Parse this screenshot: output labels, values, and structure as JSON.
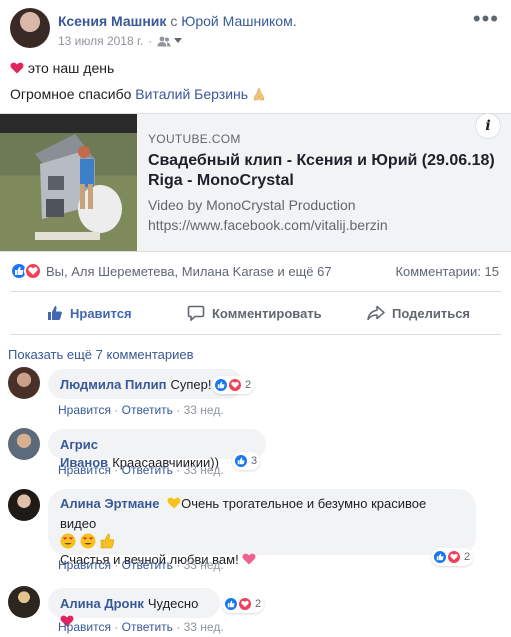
{
  "post": {
    "author": "Ксения Машник",
    "with_word": "с",
    "tagged": "Юрой Машником.",
    "date": "13 июля 2018 г.",
    "audience_icon": "friends-icon",
    "line1_text": "это наш день",
    "line2_text": "Огромное спасибо",
    "line2_link": "Виталий Берзинь"
  },
  "preview": {
    "source": "YOUTUBE.COM",
    "title": "Свадебный клип - Ксения и Юрий (29.06.18) Riga - MonoCrystal",
    "desc1": "Video by MonoCrystal Production",
    "desc2": "https://www.facebook.com/vitalij.berzin",
    "info": "i"
  },
  "reactions": {
    "summary": "Вы, Аля Шереметева, Милана Karase и ещё 67",
    "comments_count": "Комментарии: 15"
  },
  "actions": {
    "like": "Нравится",
    "comment": "Комментировать",
    "share": "Поделиться"
  },
  "comments_section": {
    "show_more": "Показать ещё 7 комментариев",
    "items": [
      {
        "name": "Людмила Пилип",
        "text": "Супер!",
        "reaction_count": "2",
        "like_label": "Нравится",
        "reply_label": "Ответить",
        "age": "33 нед."
      },
      {
        "name": "Агрис Иванов",
        "text": "Краасаавчиикии))",
        "reaction_count": "3",
        "like_label": "Нравится",
        "reply_label": "Ответить",
        "age": "33 нед."
      },
      {
        "name": "Алина Эртмане",
        "text": "Очень трогательное и безумно красивое видео",
        "text2": "Счастья и вечной любви вам!",
        "reaction_count": "2",
        "like_label": "Нравится",
        "reply_label": "Ответить",
        "age": "33 нед."
      },
      {
        "name": "Алина Дронк",
        "text": "Чудесно",
        "reaction_count": "2",
        "like_label": "Нравится",
        "reply_label": "Ответить",
        "age": "33 нед."
      }
    ],
    "separator": "·"
  },
  "colors": {
    "link": "#385898",
    "like_blue": "#1877f2",
    "love_red": "#f33e58",
    "bubble_bg": "#f2f3f5"
  }
}
